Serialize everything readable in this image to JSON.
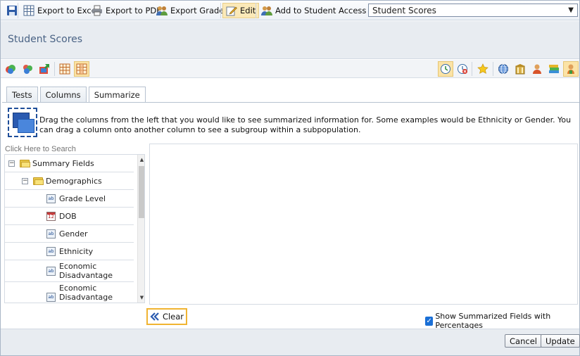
{
  "toolbar": {
    "export_excel": "Export to Excel",
    "export_pdf": "Export to PDF",
    "export_grades": "Export Grades",
    "edit": "Edit",
    "add_access": "Add to Student Access List",
    "view_select": "Student Scores"
  },
  "page": {
    "title": "Student Scores"
  },
  "tabs": [
    "Tests",
    "Columns",
    "Summarize"
  ],
  "active_tab": "Summarize",
  "instructions": "Drag the columns from the left that you would like to see summarized information for. Some examples would be Ethnicity or Gender. You can drag a column onto another column to see a subgroup within a subpopulation.",
  "search": {
    "placeholder": "Click Here to Search"
  },
  "tree": {
    "root": "Summary Fields",
    "group": "Demographics",
    "items": [
      "Grade Level",
      "DOB",
      "Gender",
      "Ethnicity",
      "Economic Disadvantage",
      "Economic Disadvantage Sub"
    ]
  },
  "actions": {
    "clear": "Clear",
    "show_pct": "Show Summarized Fields with Percentages",
    "show_pct_checked": true,
    "cancel": "Cancel",
    "update": "Update"
  },
  "icons": {
    "field_icon_text": "ab",
    "calendar_icon_text": "12"
  },
  "colors": {
    "title": "#4a6385",
    "highlight": "#fbe3a6",
    "clear_border": "#f0b432",
    "checkbox": "#1a6fd6"
  }
}
